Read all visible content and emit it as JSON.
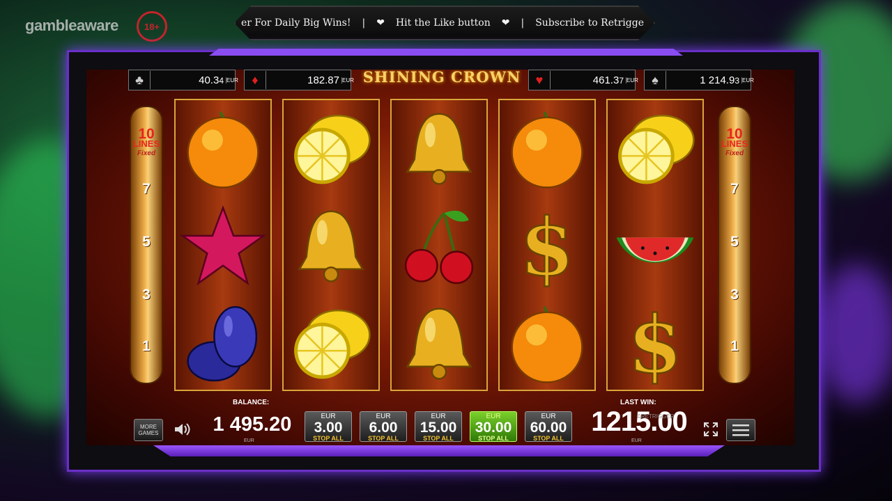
{
  "overlay": {
    "logo_text": "gambleaware",
    "age_badge": "18+",
    "ticker": [
      "er For Daily Big Wins!",
      "|",
      "❤",
      "Hit the Like button",
      "❤",
      "|",
      "Subscribe to Retrigge"
    ]
  },
  "game": {
    "title": "SHINING CROWN",
    "jackpots": [
      {
        "suit": "♣",
        "value": "40.3",
        "digit": "4",
        "cur": "EUR"
      },
      {
        "suit": "♦",
        "value": "182.87",
        "digit": "",
        "cur": "EUR"
      },
      {
        "suit": "♥",
        "value": "461.3",
        "digit": "7",
        "cur": "EUR"
      },
      {
        "suit": "♠",
        "value": "1 214.9",
        "digit": "3",
        "cur": "EUR"
      }
    ],
    "lines_panel": {
      "count": "10",
      "label": "LINES",
      "fixed": "Fixed",
      "numbers": [
        "7",
        "5",
        "3",
        "1"
      ]
    },
    "reels": [
      [
        "orange",
        "star",
        "plum"
      ],
      [
        "lemon",
        "bell",
        "lemon"
      ],
      [
        "bell",
        "cherry",
        "bell"
      ],
      [
        "orange",
        "dollar",
        "orange"
      ],
      [
        "lemon",
        "watermelon",
        "dollar"
      ]
    ],
    "controls": {
      "more_games_label": "MORE GAMES",
      "sound_icon": "speaker-icon",
      "balance_label": "BALANCE:",
      "balance_value": "1 495.20",
      "balance_currency": "EUR",
      "bets": [
        {
          "currency": "EUR",
          "value": "3.00",
          "stop": "STOP ALL",
          "active": false
        },
        {
          "currency": "EUR",
          "value": "6.00",
          "stop": "STOP ALL",
          "active": false
        },
        {
          "currency": "EUR",
          "value": "15.00",
          "stop": "STOP ALL",
          "active": false
        },
        {
          "currency": "EUR",
          "value": "30.00",
          "stop": "STOP ALL",
          "active": true
        },
        {
          "currency": "EUR",
          "value": "60.00",
          "stop": "STOP ALL",
          "active": false
        }
      ],
      "last_win_label": "LAST WIN:",
      "last_win_value": "1215.00",
      "last_win_currency": "EUR",
      "watermark": "©RETRIGGER",
      "fullscreen_icon": "fullscreen-icon",
      "menu_icon": "hamburger-menu-icon"
    }
  },
  "colors": {
    "frame": "#6a2fc8",
    "active_bet": "#4caf1a",
    "lines_text": "#e8261c"
  }
}
